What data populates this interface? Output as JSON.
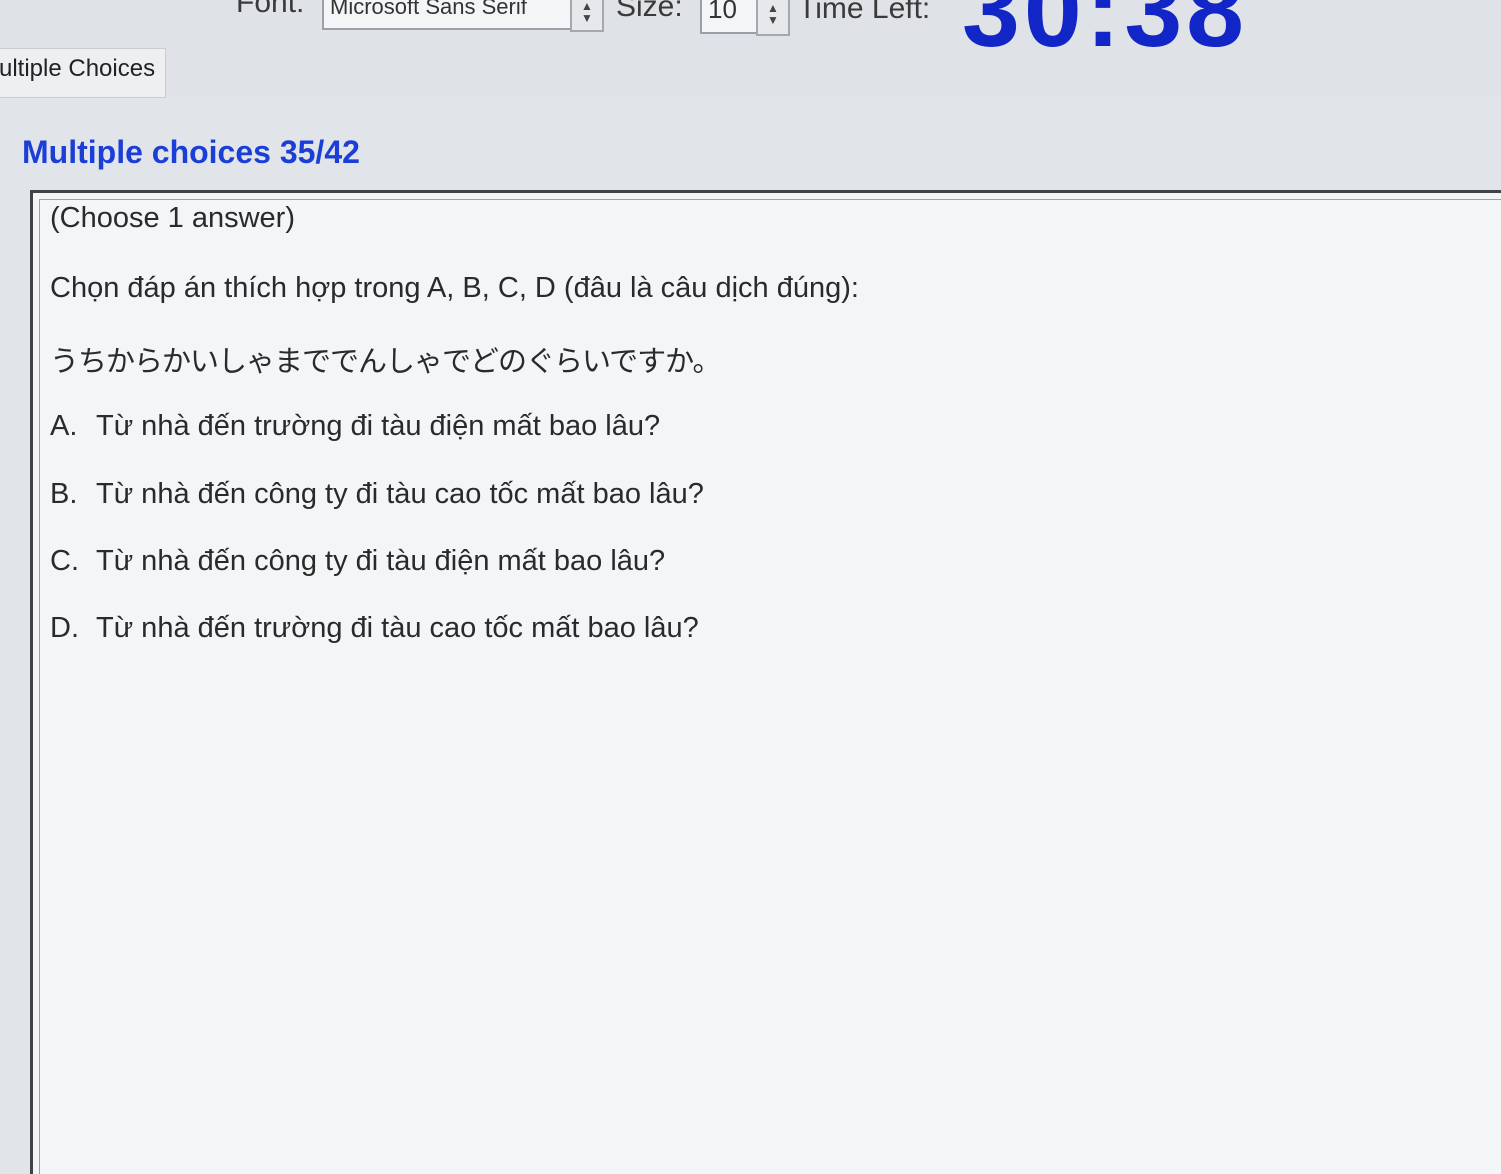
{
  "toolbar": {
    "font_label": "Font:",
    "font_value": "Microsoft Sans Serif",
    "size_label": "Size:",
    "size_value": "10",
    "time_label": "Time Left:",
    "time_value": "30:38"
  },
  "tab": {
    "label": "ultiple Choices"
  },
  "question": {
    "heading": "Multiple choices 35/42",
    "hint": "(Choose 1 answer)",
    "prompt": "Chọn đáp án thích hợp trong A, B, C, D (đâu là câu dịch đúng):",
    "japanese": "うちからかいしゃまででんしゃでどのぐらいですか。",
    "options": [
      {
        "key": "A.",
        "text": "Từ nhà đến trường đi tàu điện mất bao lâu?"
      },
      {
        "key": "B.",
        "text": "Từ nhà đến công ty đi tàu cao tốc mất bao lâu?"
      },
      {
        "key": "C.",
        "text": "Từ nhà đến công ty đi tàu điện mất bao lâu?"
      },
      {
        "key": "D.",
        "text": "Từ nhà đến trường đi tàu cao tốc mất bao lâu?"
      }
    ]
  },
  "colors": {
    "timer": "#1226c8",
    "heading": "#1b3fd6"
  },
  "icons": {
    "spin_up": "up-arrow-icon",
    "spin_down": "down-arrow-icon"
  }
}
